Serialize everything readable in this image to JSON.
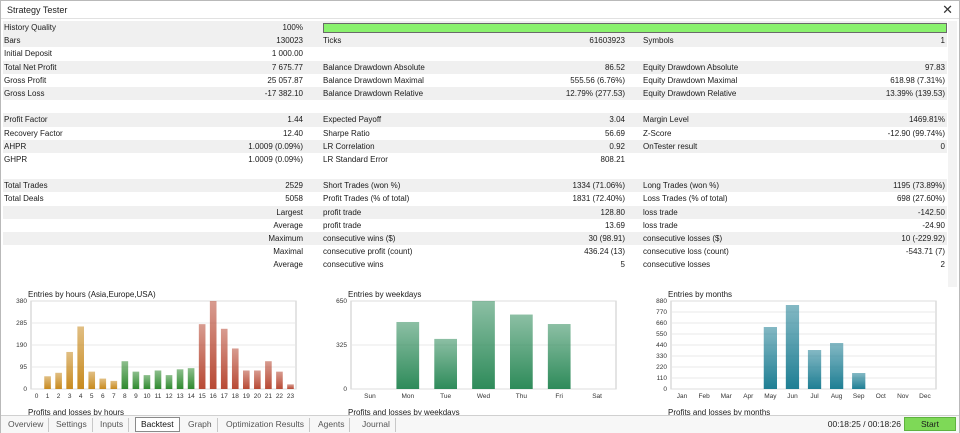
{
  "window": {
    "title": "Strategy Tester",
    "close_glyph": "✕"
  },
  "history_quality": {
    "label": "History Quality",
    "value": "100%",
    "fill_fraction": 1.0
  },
  "rows": [
    [
      [
        "Bars",
        "130023"
      ],
      [
        "Ticks",
        "61603923"
      ],
      [
        "Symbols",
        "1"
      ]
    ],
    [
      [
        "Initial Deposit",
        "1 000.00"
      ],
      [
        "",
        ""
      ],
      [
        "",
        ""
      ]
    ],
    [
      [
        "Total Net Profit",
        "7 675.77"
      ],
      [
        "Balance Drawdown Absolute",
        "86.52"
      ],
      [
        "Equity Drawdown Absolute",
        "97.83"
      ]
    ],
    [
      [
        "Gross Profit",
        "25 057.87"
      ],
      [
        "Balance Drawdown Maximal",
        "555.56 (6.76%)"
      ],
      [
        "Equity Drawdown Maximal",
        "618.98 (7.31%)"
      ]
    ],
    [
      [
        "Gross Loss",
        "-17 382.10"
      ],
      [
        "Balance Drawdown Relative",
        "12.79% (277.53)"
      ],
      [
        "Equity Drawdown Relative",
        "13.39% (139.53)"
      ]
    ],
    [
      [
        "",
        ""
      ],
      [
        "",
        ""
      ],
      [
        "",
        ""
      ]
    ],
    [
      [
        "Profit Factor",
        "1.44"
      ],
      [
        "Expected Payoff",
        "3.04"
      ],
      [
        "Margin Level",
        "1469.81%"
      ]
    ],
    [
      [
        "Recovery Factor",
        "12.40"
      ],
      [
        "Sharpe Ratio",
        "56.69"
      ],
      [
        "Z-Score",
        "-12.90 (99.74%)"
      ]
    ],
    [
      [
        "AHPR",
        "1.0009 (0.09%)"
      ],
      [
        "LR Correlation",
        "0.92"
      ],
      [
        "OnTester result",
        "0"
      ]
    ],
    [
      [
        "GHPR",
        "1.0009 (0.09%)"
      ],
      [
        "LR Standard Error",
        "808.21"
      ],
      [
        "",
        ""
      ]
    ],
    [
      [
        "",
        ""
      ],
      [
        "",
        ""
      ],
      [
        "",
        ""
      ]
    ],
    [
      [
        "Total Trades",
        "2529"
      ],
      [
        "Short Trades (won %)",
        "1334 (71.06%)"
      ],
      [
        "Long Trades (won %)",
        "1195 (73.89%)"
      ]
    ],
    [
      [
        "Total Deals",
        "5058"
      ],
      [
        "Profit Trades (% of total)",
        "1831 (72.40%)"
      ],
      [
        "Loss Trades (% of total)",
        "698 (27.60%)"
      ]
    ],
    [
      [
        "Largest",
        ""
      ],
      [
        "profit trade",
        "128.80"
      ],
      [
        "loss trade",
        "-142.50"
      ]
    ],
    [
      [
        "Average",
        ""
      ],
      [
        "profit trade",
        "13.69"
      ],
      [
        "loss trade",
        "-24.90"
      ]
    ],
    [
      [
        "Maximum",
        ""
      ],
      [
        "consecutive wins ($)",
        "30 (98.91)"
      ],
      [
        "consecutive losses ($)",
        "10 (-229.92)"
      ]
    ],
    [
      [
        "Maximal",
        ""
      ],
      [
        "consecutive profit (count)",
        "436.24 (13)"
      ],
      [
        "consecutive loss (count)",
        "-543.71 (7)"
      ]
    ],
    [
      [
        "Average",
        ""
      ],
      [
        "consecutive wins",
        "5"
      ],
      [
        "consecutive losses",
        "2"
      ]
    ]
  ],
  "chart_data": [
    {
      "type": "bar",
      "title": "Entries by hours (Asia,Europe,USA)",
      "subtitle": "Profits and losses by hours",
      "categories": [
        "0",
        "1",
        "2",
        "3",
        "4",
        "5",
        "6",
        "7",
        "8",
        "9",
        "10",
        "11",
        "12",
        "13",
        "14",
        "15",
        "16",
        "17",
        "18",
        "19",
        "20",
        "21",
        "22",
        "23"
      ],
      "values": [
        0,
        55,
        70,
        160,
        270,
        75,
        45,
        35,
        120,
        75,
        60,
        80,
        60,
        85,
        90,
        280,
        380,
        260,
        175,
        80,
        80,
        120,
        75,
        20
      ],
      "colors": [
        "#c88a1e",
        "#c88a1e",
        "#c88a1e",
        "#c88a1e",
        "#c88a1e",
        "#c88a1e",
        "#c88a1e",
        "#c88a1e",
        "#2f8a2f",
        "#2f8a2f",
        "#2f8a2f",
        "#2f8a2f",
        "#2f8a2f",
        "#2f8a2f",
        "#2f8a2f",
        "#b84a35",
        "#b84a35",
        "#b84a35",
        "#b84a35",
        "#b84a35",
        "#b84a35",
        "#b84a35",
        "#b84a35",
        "#b84a35"
      ],
      "yticks": [
        "0",
        "95",
        "190",
        "285",
        "380"
      ],
      "ylim": [
        0,
        380
      ],
      "grid": true
    },
    {
      "type": "bar",
      "title": "Entries by weekdays",
      "subtitle": "Profits and losses by weekdays",
      "categories": [
        "Sun",
        "Mon",
        "Tue",
        "Wed",
        "Thu",
        "Fri",
        "Sat"
      ],
      "values": [
        0,
        495,
        370,
        650,
        550,
        480,
        0
      ],
      "color": "#2e8b5a",
      "yticks": [
        "0",
        "325",
        "650"
      ],
      "ylim": [
        0,
        650
      ],
      "grid": true
    },
    {
      "type": "bar",
      "title": "Entries by months",
      "subtitle": "Profits and losses by months",
      "categories": [
        "Jan",
        "Feb",
        "Mar",
        "Apr",
        "May",
        "Jun",
        "Jul",
        "Aug",
        "Sep",
        "Oct",
        "Nov",
        "Dec"
      ],
      "values": [
        0,
        0,
        0,
        0,
        620,
        840,
        390,
        460,
        160,
        0,
        0,
        0
      ],
      "color": "#1f7f94",
      "yticks": [
        "0",
        "110",
        "220",
        "330",
        "440",
        "550",
        "660",
        "770",
        "880"
      ],
      "ylim": [
        0,
        880
      ],
      "grid": true
    }
  ],
  "tabs": [
    "Overview",
    "Settings",
    "Inputs",
    "Backtest",
    "Graph",
    "Optimization Results",
    "Agents",
    "Journal"
  ],
  "active_tab": "Backtest",
  "timer": "00:18:25 / 00:18:26",
  "start_label": "Start"
}
